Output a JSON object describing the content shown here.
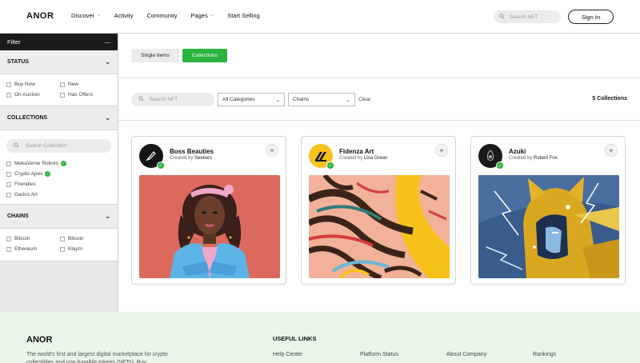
{
  "header": {
    "logo": "ANOR",
    "nav": [
      {
        "label": "Discover",
        "dropdown": true
      },
      {
        "label": "Activity",
        "dropdown": false
      },
      {
        "label": "Community",
        "dropdown": false
      },
      {
        "label": "Pages",
        "dropdown": true
      },
      {
        "label": "Start Selling",
        "dropdown": false
      }
    ],
    "search_placeholder": "Search NFT",
    "signin_label": "Sign In"
  },
  "sidebar": {
    "filter_label": "Filter",
    "status": {
      "title": "STATUS",
      "options": [
        "Buy Now",
        "New",
        "On Auction",
        "Has Offers"
      ]
    },
    "collections": {
      "title": "COLLECTIONS",
      "search_placeholder": "Search Collection",
      "items": [
        {
          "label": "MekaVerse Robots",
          "verified": true
        },
        {
          "label": "Crypto Apes",
          "verified": true
        },
        {
          "label": "Friendies",
          "verified": false
        },
        {
          "label": "Garico Art",
          "verified": false
        }
      ]
    },
    "chains": {
      "title": "CHAINS",
      "options": [
        "Bitcoin",
        "Bitcoin",
        "Ethereum",
        "Klaytn"
      ]
    }
  },
  "main": {
    "tabs": [
      {
        "label": "Single Items",
        "active": false
      },
      {
        "label": "Collections",
        "active": true
      }
    ],
    "search_placeholder": "Search NFT",
    "category_select": "All Categories",
    "chain_select": "Chains",
    "clear_label": "Clear",
    "count_text": "5 Collections",
    "cards": [
      {
        "title": "Boss Beauties",
        "created_by": "Created by",
        "creator": "Seekers",
        "avatar_icon": "feather-pen-icon"
      },
      {
        "title": "Fidenza Art",
        "created_by": "Created by",
        "creator": "Lisa Green",
        "avatar_icon": "zigzag-logo-icon"
      },
      {
        "title": "Azuki",
        "created_by": "Created by",
        "creator": "Robert Fox",
        "avatar_icon": "azuki-logo-icon"
      }
    ]
  },
  "footer": {
    "logo": "ANOR",
    "description": "The world's first and largest digital marketplace for crypto collectibles and non-fungible tokens (NFTs). Buy,",
    "useful_links_title": "USEFUL LINKS",
    "links": [
      "Help Center",
      "Platform Status",
      "About Company",
      "Rankings"
    ]
  },
  "colors": {
    "accent": "#2bb33d",
    "footer_bg": "#e9f5e9",
    "filter_bar": "#1b1b1b"
  }
}
